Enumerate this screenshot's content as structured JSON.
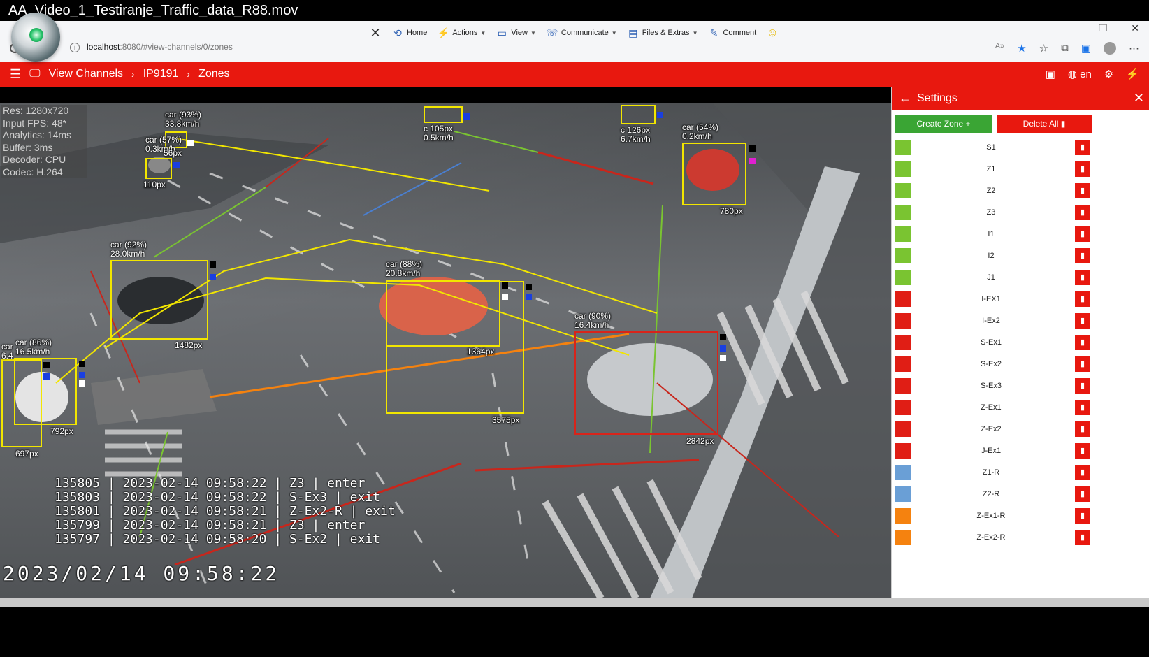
{
  "window": {
    "title": "AA_Video_1_Testiranje_Traffic_data_R88.mov"
  },
  "browser": {
    "url_host": "localhost",
    "url_rest": ":8080/#view-channels/0/zones",
    "toolbar": [
      "Home",
      "Actions",
      "View",
      "Communicate",
      "Files & Extras",
      "Comment"
    ]
  },
  "app": {
    "breadcrumb": [
      "View Channels",
      "IP9191",
      "Zones"
    ],
    "language": "en"
  },
  "video": {
    "stats": [
      "Res: 1280x720",
      "Input FPS: 48*",
      "Analytics: 14ms",
      "Buffer: 3ms",
      "Decoder: CPU",
      "Codec: H.264"
    ],
    "detections": [
      {
        "label": "car (93%)",
        "speed": "33.8km/h"
      },
      {
        "label": "car (57%)",
        "speed": "0.3km/h",
        "px": "56px"
      },
      {
        "px": "110px"
      },
      {
        "label": "c 105px",
        "speed": "0.5km/h"
      },
      {
        "label": "c 126px",
        "speed": "6.7km/h"
      },
      {
        "label": "car (54%)",
        "speed": "0.2km/h",
        "px": "780px"
      },
      {
        "label": "car (92%)",
        "speed": "28.0km/h",
        "px": "1482px"
      },
      {
        "label": "car (88%)",
        "speed": "20.8km/h",
        "px": "1364px"
      },
      {
        "px": "3575px"
      },
      {
        "label": "car (90%)",
        "speed": "16.4km/h",
        "px": "2842px"
      },
      {
        "label": "car (86%)",
        "speed": "16.5km/h",
        "px": "792px"
      },
      {
        "label": "car",
        "speed": "6.4",
        "px": "697px"
      }
    ],
    "events": [
      "135805 | 2023-02-14 09:58:22 | Z3 | enter",
      "135803 | 2023-02-14 09:58:22 | S-Ex3 | exit",
      "135801 | 2023-02-14 09:58:21 | Z-Ex2-R | exit",
      "135799 | 2023-02-14 09:58:21 | Z3 | enter",
      "135797 | 2023-02-14 09:58:20 | S-Ex2 | exit"
    ],
    "timestamp": "2023/02/14 09:58:22"
  },
  "settings": {
    "title": "Settings",
    "create_zone": "Create Zone +",
    "delete_all": "Delete All",
    "zones": [
      {
        "name": "S1",
        "color": "#7ac431"
      },
      {
        "name": "Z1",
        "color": "#7ac431"
      },
      {
        "name": "Z2",
        "color": "#7ac431"
      },
      {
        "name": "Z3",
        "color": "#7ac431"
      },
      {
        "name": "I1",
        "color": "#7ac431"
      },
      {
        "name": "I2",
        "color": "#7ac431"
      },
      {
        "name": "J1",
        "color": "#7ac431"
      },
      {
        "name": "I-EX1",
        "color": "#e01e15"
      },
      {
        "name": "I-Ex2",
        "color": "#e01e15"
      },
      {
        "name": "S-Ex1",
        "color": "#e01e15"
      },
      {
        "name": "S-Ex2",
        "color": "#e01e15"
      },
      {
        "name": "S-Ex3",
        "color": "#e01e15"
      },
      {
        "name": "Z-Ex1",
        "color": "#e01e15"
      },
      {
        "name": "Z-Ex2",
        "color": "#e01e15"
      },
      {
        "name": "J-Ex1",
        "color": "#e01e15"
      },
      {
        "name": "Z1-R",
        "color": "#6a9fd6"
      },
      {
        "name": "Z2-R",
        "color": "#6a9fd6"
      },
      {
        "name": "Z-Ex1-R",
        "color": "#f5820f"
      },
      {
        "name": "Z-Ex2-R",
        "color": "#f5820f"
      }
    ]
  }
}
